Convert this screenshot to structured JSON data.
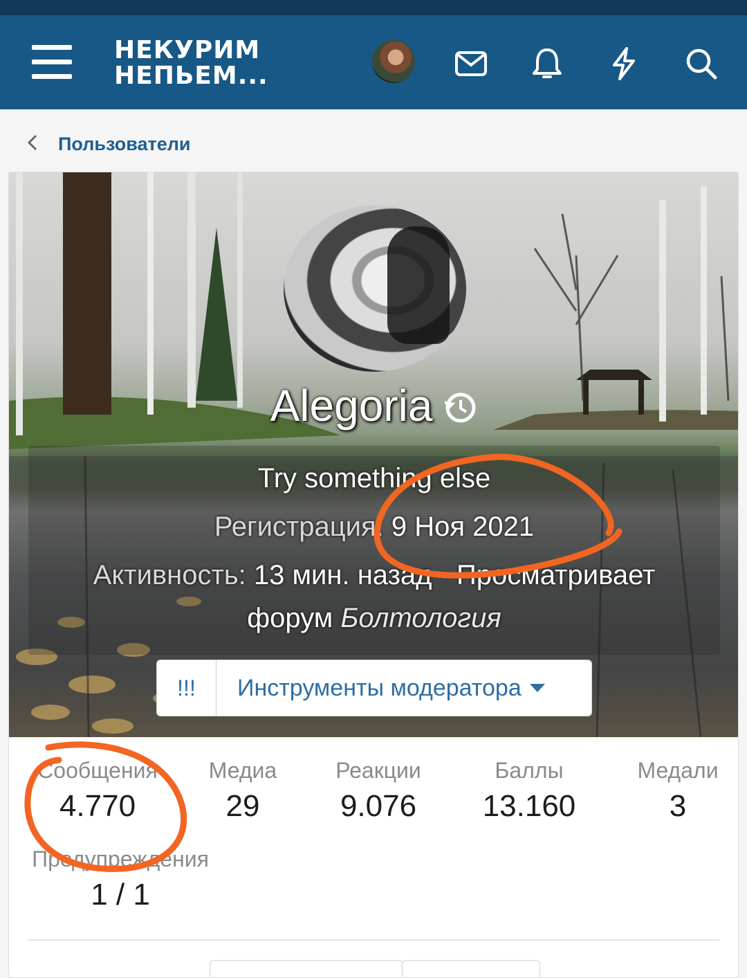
{
  "header": {
    "logo_line1": "НЕКУРИМ",
    "logo_line2": "НЕПЬЕМ...",
    "icons": [
      "menu-icon",
      "avatar",
      "mail-icon",
      "bell-icon",
      "lightning-icon",
      "search-icon"
    ]
  },
  "breadcrumb": {
    "label": "Пользователи"
  },
  "profile": {
    "username": "Alegoria",
    "custom_title": "Try something else",
    "registration_label": "Регистрация:",
    "registration_date": "9 Ноя 2021",
    "activity_label": "Активность:",
    "activity_value": "13 мин. назад · Просматривает",
    "activity_value2": "форум",
    "activity_forum": "Болтология"
  },
  "moderator": {
    "warn_label": "!!!",
    "tools_label": "Инструменты модератора"
  },
  "stats": [
    {
      "label": "Сообщения",
      "value": "4.770"
    },
    {
      "label": "Медиа",
      "value": "29"
    },
    {
      "label": "Реакции",
      "value": "9.076"
    },
    {
      "label": "Баллы",
      "value": "13.160"
    },
    {
      "label": "Медали",
      "value": "3"
    },
    {
      "label": "Предупреждения",
      "value": "1 / 1"
    }
  ],
  "colors": {
    "header_bg": "#185886",
    "link": "#1e5f92",
    "annotation": "#f26522"
  }
}
